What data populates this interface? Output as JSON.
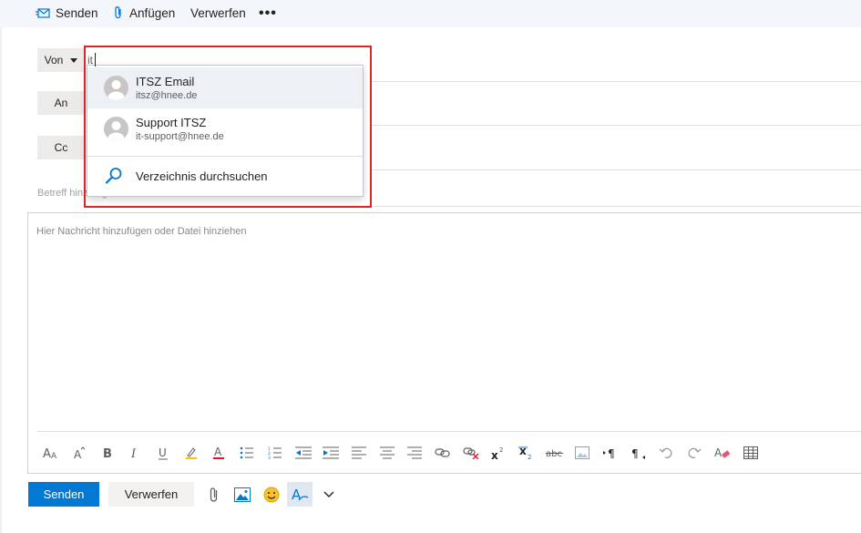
{
  "toolbar": {
    "send_label": "Senden",
    "attach_label": "Anfügen",
    "discard_label": "Verwerfen",
    "more_label": "•••"
  },
  "header": {
    "from_label": "Von",
    "to_label": "An",
    "cc_label": "Cc",
    "from_value": "it",
    "subject_placeholder": "Betreff hinzufügen"
  },
  "autocomplete": {
    "suggestions": [
      {
        "name": "ITSZ Email",
        "email": "itsz@hnee.de"
      },
      {
        "name": "Support ITSZ",
        "email": "it-support@hnee.de"
      }
    ],
    "directory_label": "Verzeichnis durchsuchen"
  },
  "body": {
    "placeholder": "Hier Nachricht hinzufügen oder Datei hinziehen"
  },
  "format_tools": [
    "font-size-icon",
    "grow-font-icon",
    "bold-icon",
    "italic-icon",
    "underline-icon",
    "highlight-icon",
    "font-color-icon",
    "bullets-icon",
    "numbering-icon",
    "decrease-indent-icon",
    "increase-indent-icon",
    "align-left-icon",
    "align-center-icon",
    "align-right-icon",
    "link-icon",
    "unlink-icon",
    "superscript-icon",
    "subscript-icon",
    "strikethrough-icon",
    "image-inline-icon",
    "ltr-icon",
    "rtl-icon",
    "undo-icon",
    "redo-icon",
    "clear-format-icon",
    "table-icon"
  ],
  "actions": {
    "send_label": "Senden",
    "discard_label": "Verwerfen"
  },
  "colors": {
    "accent": "#0078d4",
    "highlight_border": "#d9262c"
  }
}
